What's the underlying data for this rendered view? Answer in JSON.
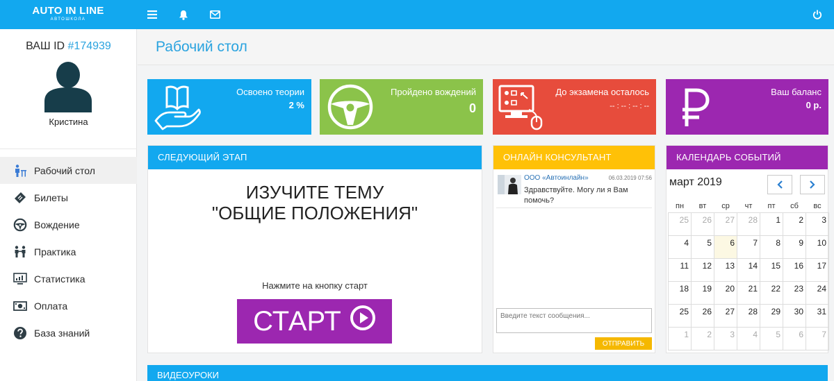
{
  "brand": {
    "name": "AUTO IN LINE",
    "tagline": "АВТОШКОЛА"
  },
  "colors": {
    "blue": "#12a8ef",
    "green": "#8bc34a",
    "red": "#e74c3c",
    "purple": "#9c27b0",
    "yellow": "#ffc107"
  },
  "topbar": {
    "icons": [
      "menu-icon",
      "bell-icon",
      "mail-icon",
      "power-icon"
    ]
  },
  "sidebar": {
    "id_label": "ВАШ ID ",
    "id_value": "#174939",
    "user_name": "Кристина",
    "items": [
      {
        "label": "Рабочий стол",
        "icon": "desk-icon",
        "active": true
      },
      {
        "label": "Билеты",
        "icon": "ticket-icon"
      },
      {
        "label": "Вождение",
        "icon": "steering-wheel-icon"
      },
      {
        "label": "Практика",
        "icon": "practice-icon"
      },
      {
        "label": "Статистика",
        "icon": "stats-icon"
      },
      {
        "label": "Оплата",
        "icon": "payment-icon"
      },
      {
        "label": "База знаний",
        "icon": "question-icon"
      }
    ]
  },
  "page": {
    "title": "Рабочий стол"
  },
  "tiles": [
    {
      "label": "Освоено теории",
      "value": "2 %",
      "icon": "book-hand-icon"
    },
    {
      "label": "Пройдено вождений",
      "value": "0",
      "icon": "steering-wheel-icon"
    },
    {
      "label": "До экзамена осталось",
      "value": "-- : -- : -- : --",
      "icon": "monitor-icon"
    },
    {
      "label": "Ваш баланс",
      "value": "0 р.",
      "icon": "ruble-icon"
    }
  ],
  "next_stage": {
    "header": "СЛЕДУЮЩИЙ ЭТАП",
    "line1": "ИЗУЧИТЕ ТЕМУ",
    "line2": "\"ОБЩИЕ ПОЛОЖЕНИЯ\"",
    "hint": "Нажмите на кнопку старт",
    "start_label": "СТАРТ"
  },
  "chat": {
    "header": "ОНЛАЙН КОНСУЛЬТАНТ",
    "message": {
      "from": "ООО «Автоинлайн»",
      "time": "06.03.2019 07:56",
      "text": "Здравствуйте. Могу ли я Вам помочь?"
    },
    "input_placeholder": "Введите текст сообщения...",
    "send_label": "ОТПРАВИТЬ"
  },
  "calendar": {
    "header": "КАЛЕНДАРЬ СОБЫТИЙ",
    "month": "март 2019",
    "weekdays": [
      "пн",
      "вт",
      "ср",
      "чт",
      "пт",
      "сб",
      "вс"
    ],
    "weeks": [
      [
        "25",
        "26",
        "27",
        "28",
        "1",
        "2",
        "3"
      ],
      [
        "4",
        "5",
        "6",
        "7",
        "8",
        "9",
        "10"
      ],
      [
        "11",
        "12",
        "13",
        "14",
        "15",
        "16",
        "17"
      ],
      [
        "18",
        "19",
        "20",
        "21",
        "22",
        "23",
        "24"
      ],
      [
        "25",
        "26",
        "27",
        "28",
        "29",
        "30",
        "31"
      ],
      [
        "1",
        "2",
        "3",
        "4",
        "5",
        "6",
        "7"
      ]
    ],
    "today": "6"
  },
  "video": {
    "header": "ВИДЕОУРОКИ"
  }
}
